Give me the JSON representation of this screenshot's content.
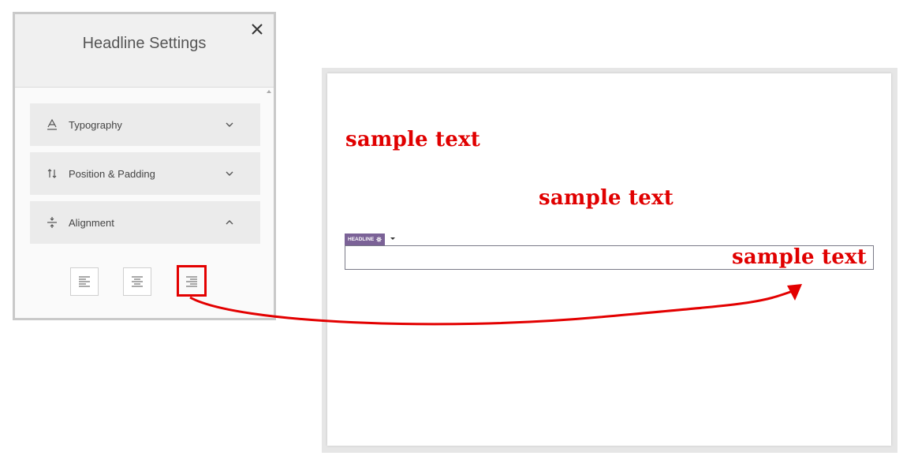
{
  "panel": {
    "title": "Headline Settings",
    "close_icon": "close-icon",
    "sections": [
      {
        "label": "Typography",
        "icon": "typography-icon",
        "state": "collapsed"
      },
      {
        "label": "Position & Padding",
        "icon": "position-padding-icon",
        "state": "collapsed"
      },
      {
        "label": "Alignment",
        "icon": "alignment-icon",
        "state": "expanded"
      }
    ],
    "alignment_options": [
      "align-left-icon",
      "align-center-icon",
      "align-right-icon"
    ],
    "selected_alignment": "right"
  },
  "preview": {
    "headline_tag": "HEADLINE",
    "samples": {
      "left": "sample text",
      "center": "sample text",
      "right": "sample text"
    }
  },
  "colors": {
    "highlight": "#e30000",
    "sample_text": "#e00000",
    "tag": "#7b6297"
  }
}
